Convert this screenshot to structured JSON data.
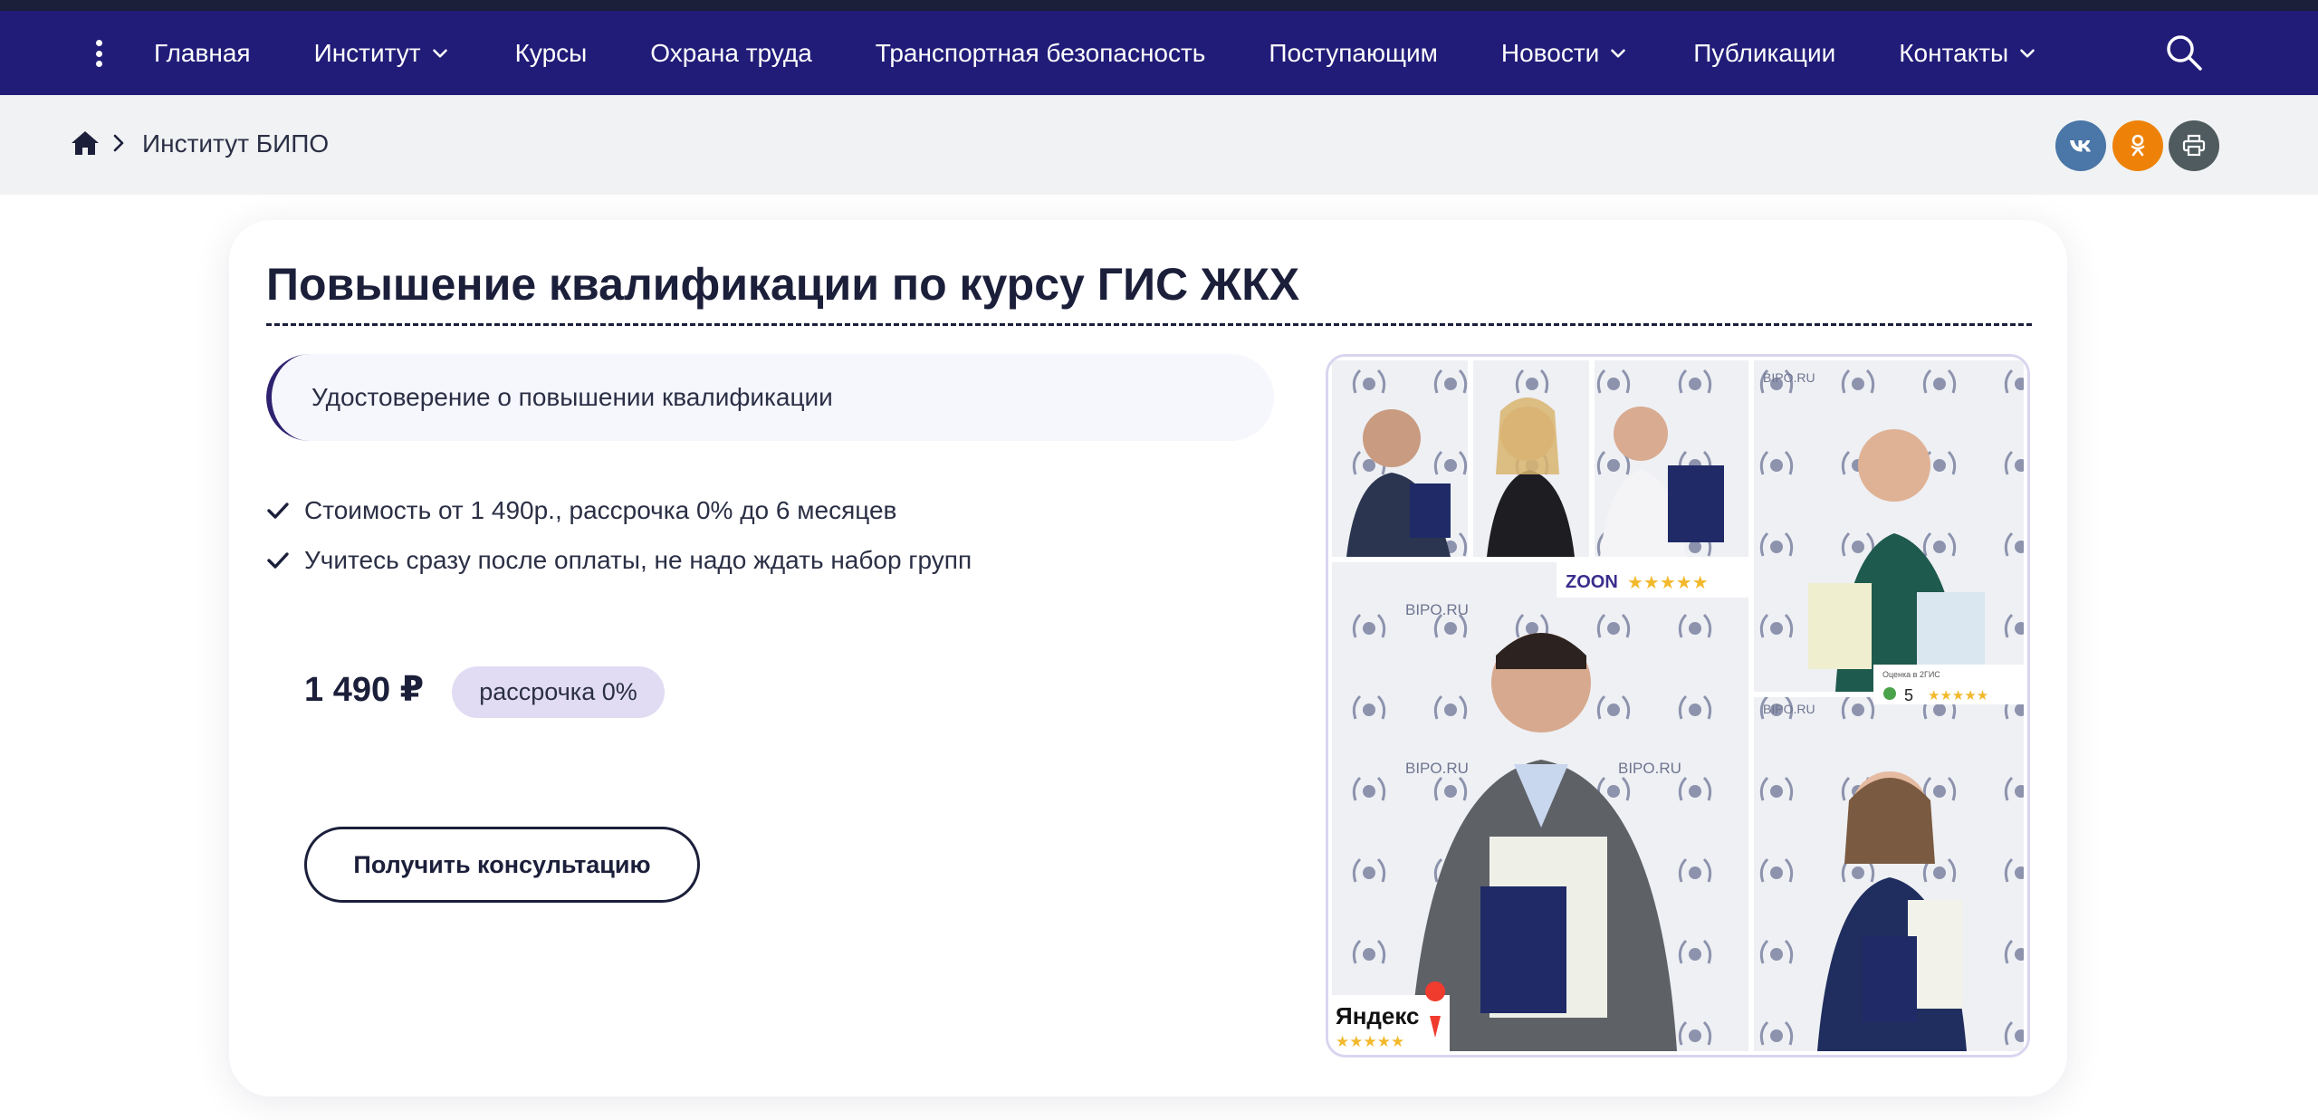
{
  "nav": {
    "items": [
      {
        "label": "Главная",
        "has_dropdown": false
      },
      {
        "label": "Институт",
        "has_dropdown": true
      },
      {
        "label": "Курсы",
        "has_dropdown": false
      },
      {
        "label": "Охрана труда",
        "has_dropdown": false
      },
      {
        "label": "Транспортная безопасность",
        "has_dropdown": false
      },
      {
        "label": "Поступающим",
        "has_dropdown": false
      },
      {
        "label": "Новости",
        "has_dropdown": true
      },
      {
        "label": "Публикации",
        "has_dropdown": false
      },
      {
        "label": "Контакты",
        "has_dropdown": true
      }
    ]
  },
  "breadcrumb": {
    "current": "Институт БИПО"
  },
  "share": {
    "icons": [
      "vk-icon",
      "odnoklassniki-icon",
      "print-icon"
    ]
  },
  "course": {
    "title": "Повышение квалификации по курсу ГИС ЖКХ",
    "certificate": "Удостоверение о повышении квалификации",
    "features": [
      "Стоимость от 1 490р., рассрочка 0% до 6 месяцев",
      "Учитесь сразу после оплаты, не надо ждать набор групп"
    ],
    "price": "1 490 ₽",
    "installment_badge": "рассрочка 0%",
    "cta_label": "Получить консультацию"
  },
  "collage": {
    "brand_watermark": "BIPO.RU",
    "zoon_label": "ZOON",
    "twogis_caption": "Оценка в 2ГИС",
    "twogis_score": "5",
    "yandex_label": "Яндекс"
  },
  "colors": {
    "nav_bg": "#211c78",
    "title": "#1b1f3a",
    "badge_bg": "#e1dcf3",
    "vk": "#4a76a8",
    "ok": "#ee8208",
    "print": "#4f5b5f"
  }
}
